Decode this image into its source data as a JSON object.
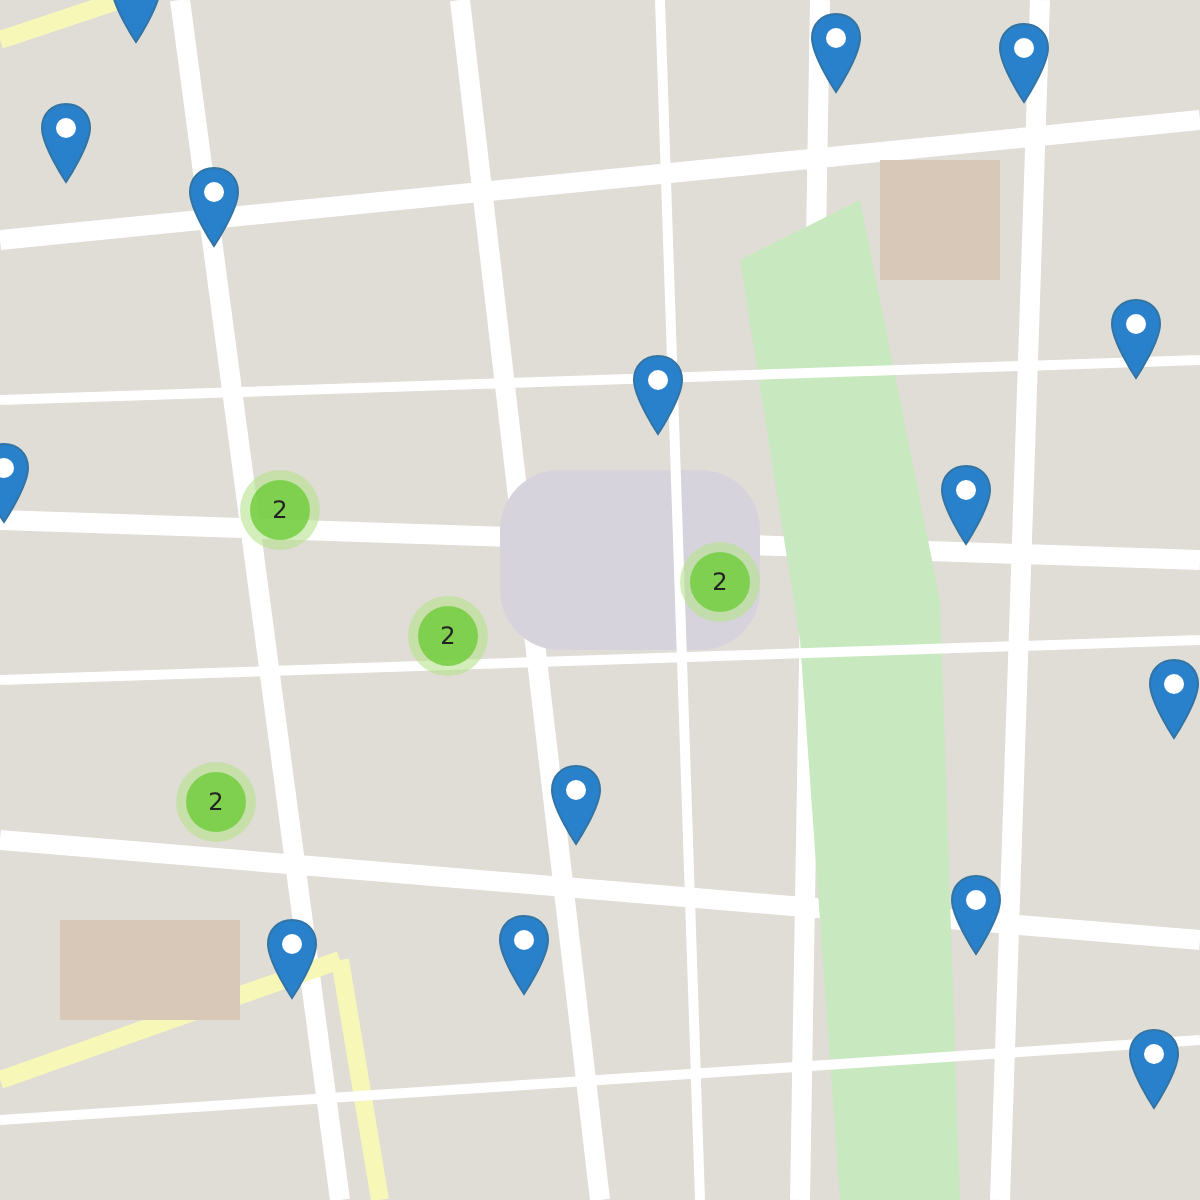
{
  "markers": [
    {
      "kind": "pin"
    },
    {
      "kind": "pin"
    },
    {
      "kind": "pin"
    },
    {
      "kind": "pin"
    },
    {
      "kind": "pin"
    },
    {
      "kind": "pin"
    },
    {
      "kind": "pin"
    },
    {
      "kind": "pin"
    },
    {
      "kind": "pin"
    },
    {
      "kind": "pin"
    },
    {
      "kind": "pin"
    },
    {
      "kind": "pin"
    },
    {
      "kind": "pin"
    },
    {
      "kind": "pin"
    },
    {
      "kind": "pin"
    }
  ],
  "clusters": [
    {
      "count": "2"
    },
    {
      "count": "2"
    },
    {
      "count": "2"
    },
    {
      "count": "2"
    }
  ]
}
